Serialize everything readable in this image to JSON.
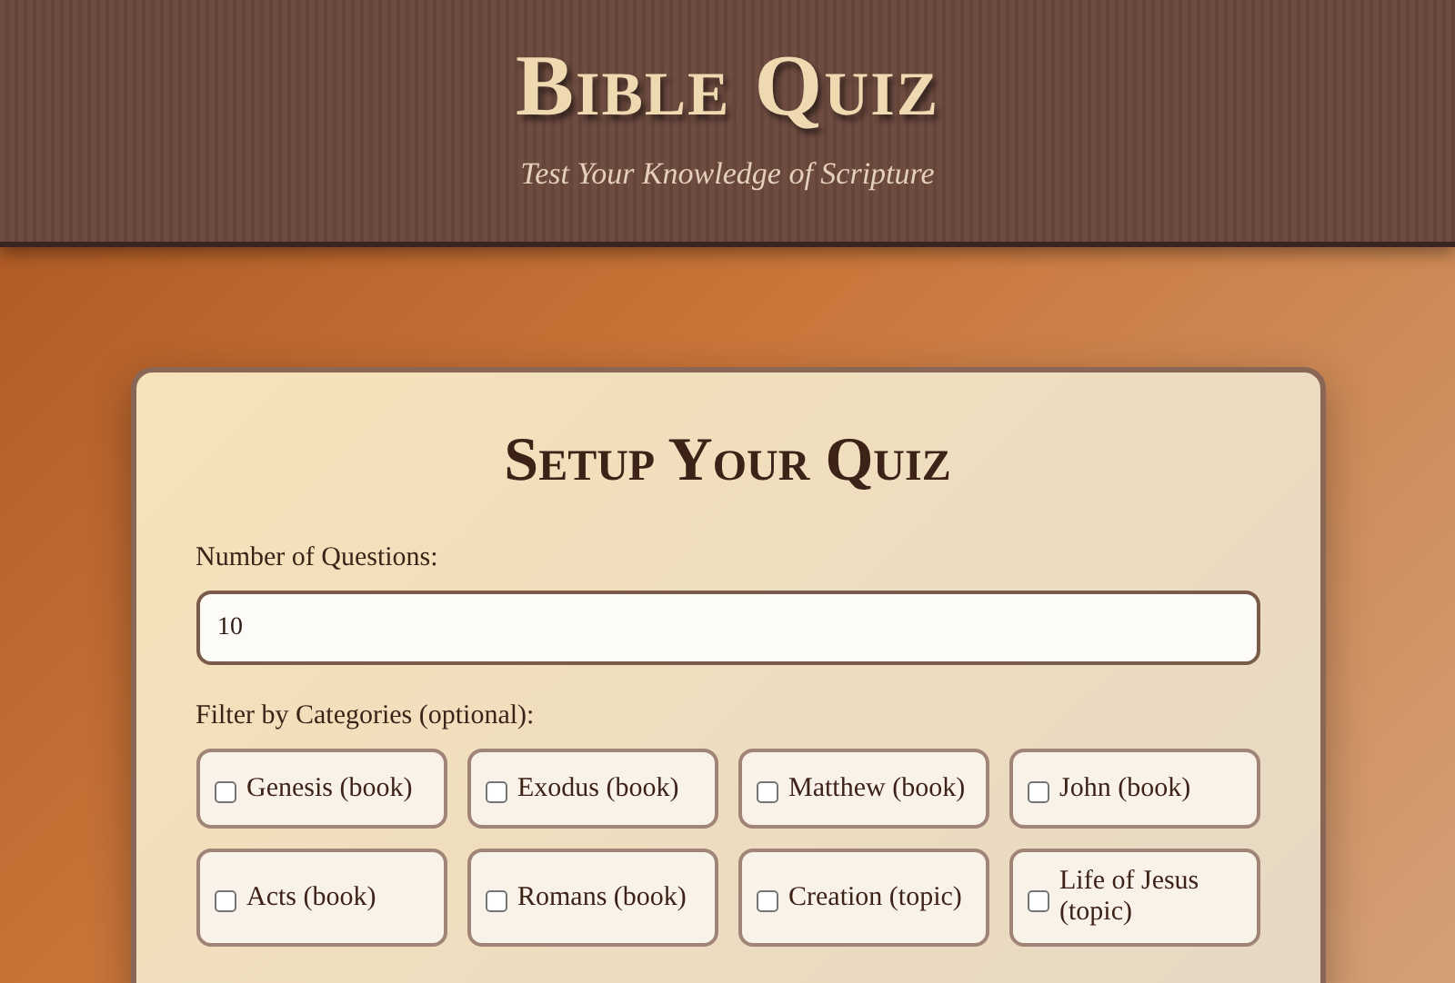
{
  "header": {
    "title": "Bible Quiz",
    "subtitle": "Test Your Knowledge of Scripture"
  },
  "setup": {
    "heading": "Setup Your Quiz",
    "questions_label": "Number of Questions:",
    "questions_value": "10",
    "categories_label": "Filter by Categories (optional):",
    "categories": [
      {
        "label": "Genesis (book)",
        "checked": false
      },
      {
        "label": "Exodus (book)",
        "checked": false
      },
      {
        "label": "Matthew (book)",
        "checked": false
      },
      {
        "label": "John (book)",
        "checked": false
      },
      {
        "label": "Acts (book)",
        "checked": false
      },
      {
        "label": "Romans (book)",
        "checked": false
      },
      {
        "label": "Creation (topic)",
        "checked": false
      },
      {
        "label": "Life of Jesus (topic)",
        "checked": false
      }
    ]
  }
}
